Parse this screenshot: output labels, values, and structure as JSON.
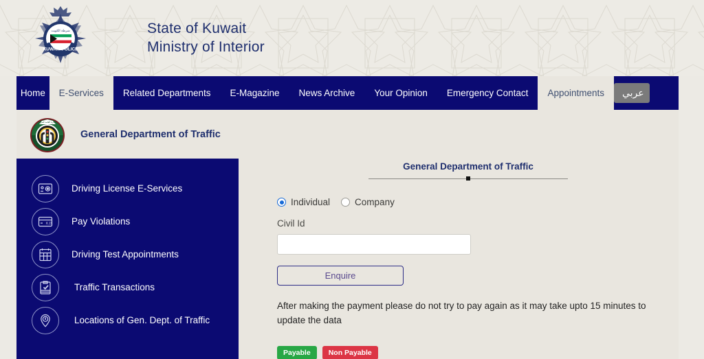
{
  "header": {
    "emblem_icon": "kuwait-police-emblem",
    "title_line1": "State of Kuwait",
    "title_line2": "Ministry of Interior"
  },
  "nav": {
    "items": [
      {
        "label": "Home",
        "active": false
      },
      {
        "label": "E-Services",
        "active": true
      },
      {
        "label": "Related Departments",
        "active": false
      },
      {
        "label": "E-Magazine",
        "active": false
      },
      {
        "label": "News Archive",
        "active": false
      },
      {
        "label": "Your Opinion",
        "active": false
      },
      {
        "label": "Emergency Contact",
        "active": false
      },
      {
        "label": "Appointments",
        "active": true
      }
    ],
    "lang_button": "عربي"
  },
  "subheader": {
    "logo_icon": "general-department-of-traffic-logo",
    "title": "General Department of Traffic"
  },
  "sidebar": {
    "items": [
      {
        "label": "Driving License E-Services",
        "icon": "driving-license-card-icon"
      },
      {
        "label": "Pay Violations",
        "icon": "payment-card-kd-icon"
      },
      {
        "label": "Driving Test Appointments",
        "icon": "calendar-icon"
      },
      {
        "label": "Traffic Transactions",
        "icon": "clipboard-check-icon"
      },
      {
        "label": "Locations of Gen. Dept. of Traffic",
        "icon": "map-pin-icon"
      }
    ]
  },
  "main": {
    "heading": "General Department of Traffic",
    "account_type": {
      "options": [
        {
          "label": "Individual",
          "checked": true
        },
        {
          "label": "Company",
          "checked": false
        }
      ]
    },
    "civil_id": {
      "label": "Civil Id",
      "value": "",
      "placeholder": ""
    },
    "enquire_button": "Enquire",
    "notice": "After making the payment please do not try to pay again as it may take upto 15 minutes to update the data",
    "badges": [
      {
        "label": "Payable",
        "color": "#28a745"
      },
      {
        "label": "Non Payable",
        "color": "#dc3545"
      }
    ]
  },
  "colors": {
    "navy": "#0b0a72",
    "page_bg": "#e9e6df",
    "accent_blue": "#1f2f6e"
  }
}
